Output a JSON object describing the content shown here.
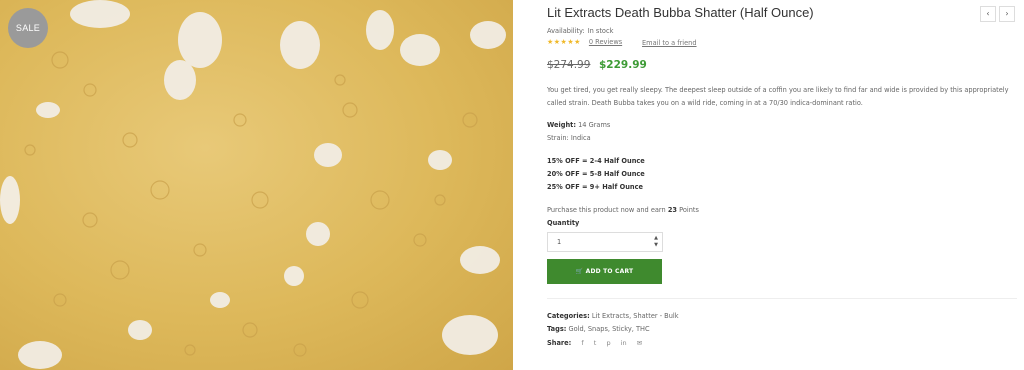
{
  "product": {
    "title": "Lit Extracts Death Bubba Shatter (Half Ounce)",
    "sale_badge": "SALE",
    "availability_label": "Availability:",
    "availability_value": "In stock",
    "stars": "★★★★★",
    "reviews_text": "0 Reviews",
    "email_friend": "Email to a friend",
    "old_price": "$274.99",
    "new_price": "$229.99",
    "description": "You get tired, you get really sleepy. The deepest sleep outside of a coffin you are likely to find far and wide is provided by this appropriately called strain. Death Bubba takes you on a wild ride, coming in at a 70/30 indica-dominant ratio.",
    "weight_label": "Weight:",
    "weight_value": "14 Grams",
    "strain_text": "Strain: Indica",
    "discounts": [
      "15% OFF = 2-4 Half Ounce",
      "20% OFF = 5-8 Half Ounce",
      "25% OFF = 9+ Half Ounce"
    ],
    "points_prefix": "Purchase this product now and earn",
    "points_value": "23",
    "points_suffix": "Points",
    "quantity_label": "Quantity",
    "quantity_value": "1",
    "add_to_cart": "ADD TO CART",
    "categories_label": "Categories:",
    "categories_value": "Lit Extracts, Shatter - Bulk",
    "tags_label": "Tags:",
    "tags_value": "Gold, Snaps, Sticky, THC",
    "share_label": "Share:"
  },
  "nav": {
    "prev": "‹",
    "next": "›"
  },
  "share_icons": [
    "facebook-icon",
    "twitter-icon",
    "pinterest-icon",
    "linkedin-icon",
    "email-icon"
  ],
  "colors": {
    "accent_green": "#3d9b35",
    "cart_button": "#3f8a2e",
    "star": "#f0b92a",
    "sale_badge": "#9a9a9a"
  }
}
